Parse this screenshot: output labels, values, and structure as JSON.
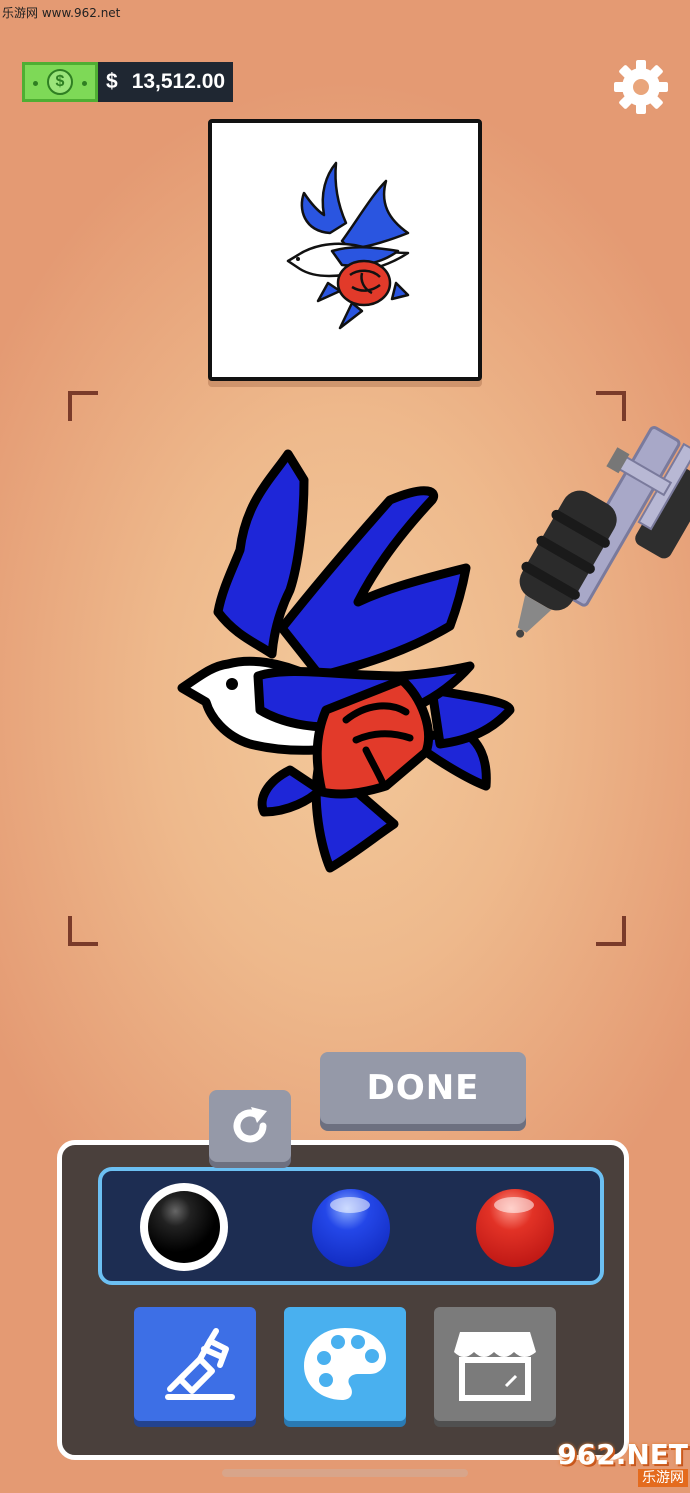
{
  "watermark": {
    "top_text": "乐游网 www.962.net",
    "logo_main": "962.NET",
    "logo_sub": "乐游网"
  },
  "hud": {
    "currency_symbol": "$",
    "money": "13,512.00",
    "money_icon": "dollar-bill-icon",
    "settings_icon": "gear-icon"
  },
  "reference": {
    "icon": "swallow-rose-tattoo-icon"
  },
  "actions": {
    "done_label": "DONE",
    "redo_icon": "redo-icon"
  },
  "palette": {
    "colors": [
      {
        "name": "black",
        "hex": "#000000",
        "selected": true
      },
      {
        "name": "blue",
        "hex": "#1b39d9",
        "selected": false
      },
      {
        "name": "red",
        "hex": "#d8281f",
        "selected": false
      }
    ]
  },
  "tools": [
    {
      "icon": "tattoo-machine-icon",
      "color": "#3d6fe6"
    },
    {
      "icon": "paint-palette-icon",
      "color": "#49b0ef"
    },
    {
      "icon": "shop-icon",
      "color": "#7b7b7b"
    }
  ]
}
